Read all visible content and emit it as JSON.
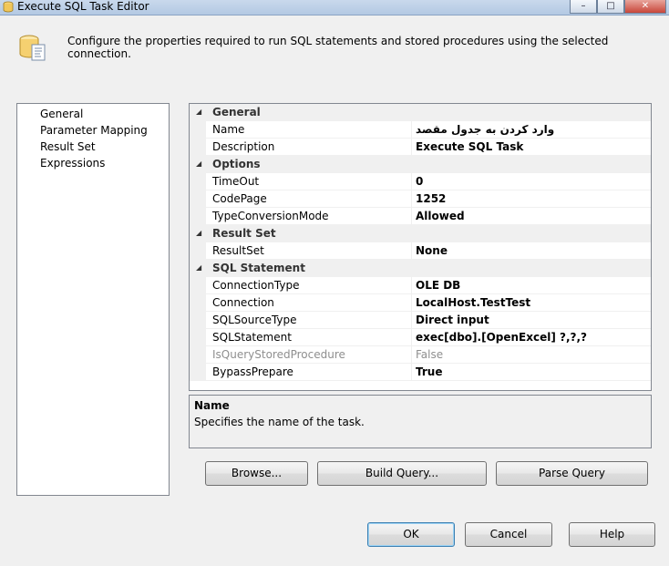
{
  "window": {
    "title": "Execute SQL Task Editor",
    "controls": [
      "minimize",
      "maximize",
      "close"
    ]
  },
  "header": {
    "description": "Configure the properties required to run SQL statements and stored procedures using the selected connection."
  },
  "nav": {
    "items": [
      "General",
      "Parameter Mapping",
      "Result Set",
      "Expressions"
    ],
    "selected": "General"
  },
  "properties": {
    "categories": [
      {
        "label": "General",
        "rows": [
          {
            "name": "Name",
            "value": "وارد کردن به جدول مقصد"
          },
          {
            "name": "Description",
            "value": "Execute SQL Task"
          }
        ]
      },
      {
        "label": "Options",
        "rows": [
          {
            "name": "TimeOut",
            "value": "0"
          },
          {
            "name": "CodePage",
            "value": "1252"
          },
          {
            "name": "TypeConversionMode",
            "value": "Allowed"
          }
        ]
      },
      {
        "label": "Result Set",
        "rows": [
          {
            "name": "ResultSet",
            "value": "None"
          }
        ]
      },
      {
        "label": "SQL Statement",
        "rows": [
          {
            "name": "ConnectionType",
            "value": "OLE DB"
          },
          {
            "name": "Connection",
            "value": "LocalHost.TestTest"
          },
          {
            "name": "SQLSourceType",
            "value": "Direct input"
          },
          {
            "name": "SQLStatement",
            "value": "exec[dbo].[OpenExcel] ?,?,?"
          },
          {
            "name": "IsQueryStoredProcedure",
            "value": "False",
            "disabled": true
          },
          {
            "name": "BypassPrepare",
            "value": "True"
          }
        ]
      }
    ]
  },
  "description_panel": {
    "title": "Name",
    "text": "Specifies the name of the task."
  },
  "buttons": {
    "browse": "Browse...",
    "build_query": "Build Query...",
    "parse_query": "Parse Query",
    "ok": "OK",
    "cancel": "Cancel",
    "help": "Help"
  },
  "colors": {
    "titlebar": "#b9cde5",
    "grid_margin": "#f0f0f0",
    "disabled_text": "#8f8f8f",
    "default_button_border": "#3c7fb1"
  }
}
